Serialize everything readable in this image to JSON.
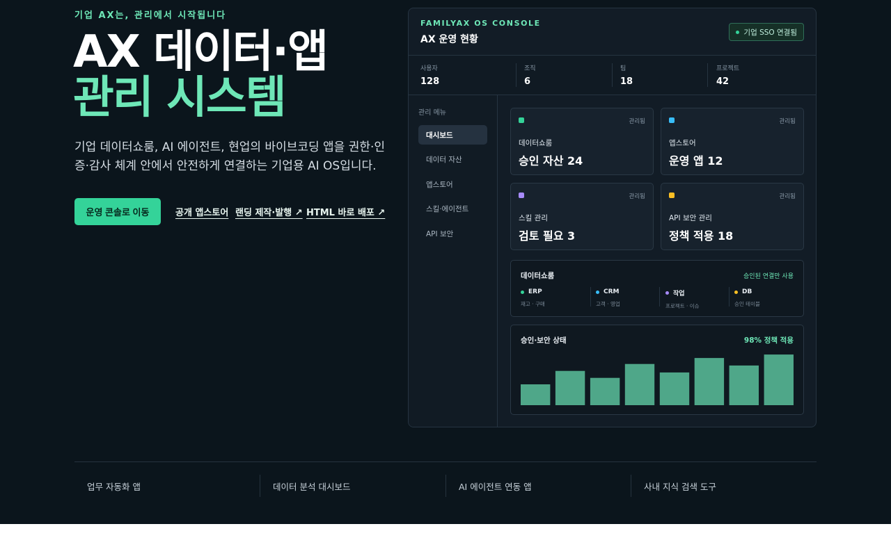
{
  "hero": {
    "eyebrow": "기업 AX는, 관리에서 시작됩니다",
    "title_line1": "AX 데이터·앱",
    "title_line2": "관리 시스템",
    "description": "기업 데이터쇼룸, AI 에이전트, 현업의 바이브코딩 앱을 권한·인증·감사 체계 안에서 안전하게 연결하는 기업용 AI OS입니다.",
    "cta_label": "운영 콘솔로 이동",
    "links": [
      "공개 앱스토어",
      "랜딩 제작·발행 ↗",
      "HTML 바로 배포 ↗"
    ]
  },
  "console": {
    "label": "FAMILYAX OS CONSOLE",
    "title": "AX 운영 현황",
    "sso_label": "기업 SSO 연결됨",
    "stats": [
      {
        "label": "사용자",
        "value": "128"
      },
      {
        "label": "조직",
        "value": "6"
      },
      {
        "label": "팀",
        "value": "18"
      },
      {
        "label": "프로젝트",
        "value": "42"
      }
    ],
    "sidebar": {
      "title": "관리 메뉴",
      "items": [
        "대시보드",
        "데이터 자산",
        "앱스토어",
        "스킬·에이전트",
        "API 보안"
      ],
      "active": "대시보드"
    },
    "cards": [
      {
        "name": "데이터쇼룸",
        "value": "승인 자산 24",
        "badge": "관리됨",
        "color": "#34d399"
      },
      {
        "name": "앱스토어",
        "value": "운영 앱 12",
        "badge": "관리됨",
        "color": "#38bdf8"
      },
      {
        "name": "스킬 관리",
        "value": "검토 필요 3",
        "badge": "관리됨",
        "color": "#a78bfa"
      },
      {
        "name": "API 보안 관리",
        "value": "정책 적용 18",
        "badge": "관리됨",
        "color": "#fbbf24"
      }
    ],
    "showroom": {
      "title": "데이터쇼룸",
      "note": "승인된 연결만 사용",
      "sources": [
        {
          "name": "ERP",
          "desc": "재고 · 구매",
          "color": "#34d399"
        },
        {
          "name": "CRM",
          "desc": "고객 · 영업",
          "color": "#38bdf8"
        },
        {
          "name": "작업",
          "desc": "프로젝트 · 이슈",
          "color": "#a78bfa"
        },
        {
          "name": "DB",
          "desc": "승인 테이블",
          "color": "#fbbf24"
        }
      ]
    },
    "security": {
      "title": "승인·보안 상태",
      "note": "98% 정책 적용",
      "chart_data": {
        "type": "bar",
        "values": [
          42,
          69,
          55,
          83,
          66,
          95,
          80,
          102
        ],
        "ylim": [
          0,
          105
        ],
        "color": "#4fa789"
      }
    }
  },
  "features": [
    "업무 자동화 앱",
    "데이터 분석 대시보드",
    "AI 에이전트 연동 앱",
    "사내 지식 검색 도구"
  ]
}
